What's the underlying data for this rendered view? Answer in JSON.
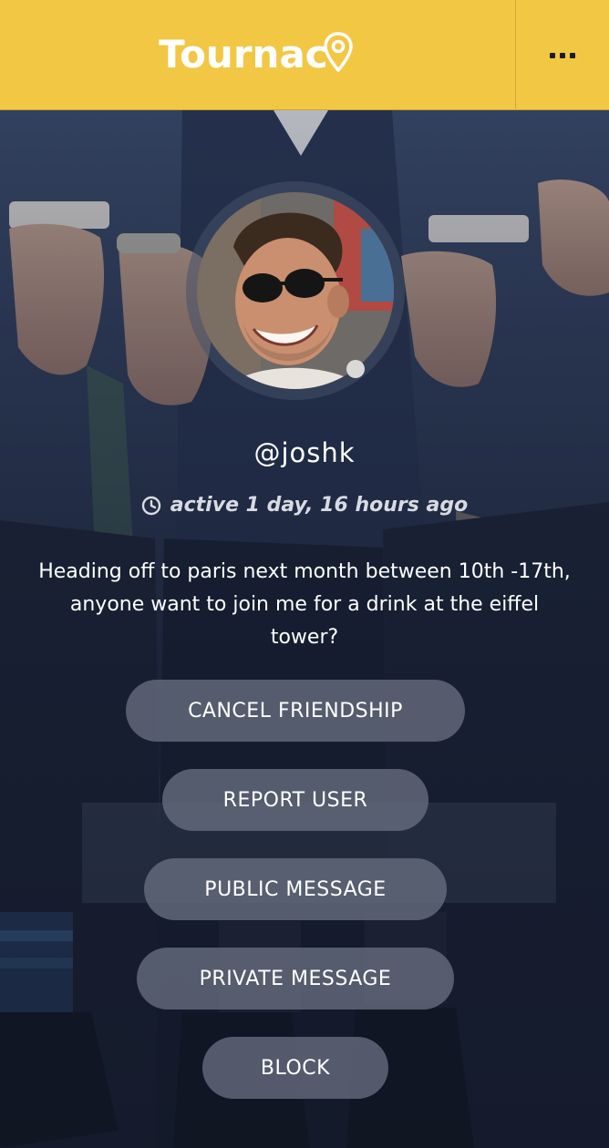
{
  "app": {
    "logo_text": "Tournac",
    "brand_color": "#f2c744",
    "logo_icon": "map-pin-icon",
    "menu_icon": "more-dots-icon"
  },
  "profile": {
    "username": "@joshk",
    "presence_icon": "clock-icon",
    "last_active": "active 1 day, 16 hours ago",
    "bio": "Heading off to paris next month between 10th -17th, anyone want to join me for a drink at the eiffel tower?",
    "status_color": "#d9d9d9"
  },
  "actions": {
    "cancel_friendship": "CANCEL FRIENDSHIP",
    "report_user": "REPORT USER",
    "public_message": "PUBLIC MESSAGE",
    "private_message": "PRIVATE MESSAGE",
    "block": "BLOCK"
  }
}
